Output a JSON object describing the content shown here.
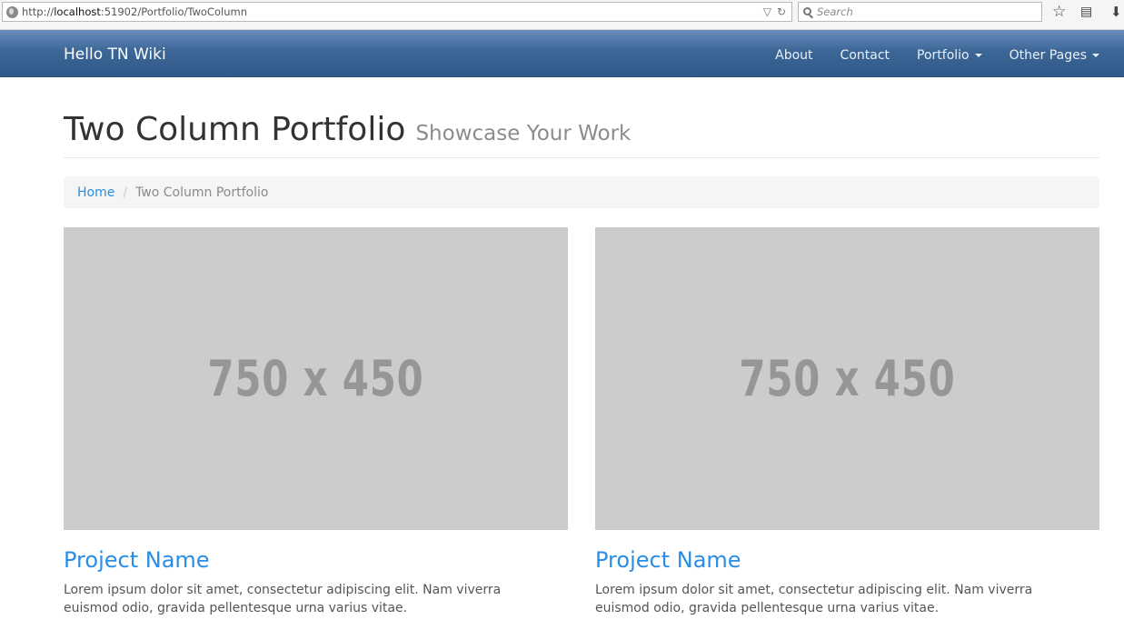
{
  "browser": {
    "url_prefix": "http://",
    "url_host": "localhost",
    "url_rest": ":51902/Portfolio/TwoColumn",
    "search_placeholder": "Search",
    "icons": [
      "globe-icon",
      "dropdown-arrow-icon",
      "reload-icon",
      "search-icon",
      "star-icon",
      "clipboard-icon",
      "download-icon"
    ]
  },
  "navbar": {
    "brand": "Hello TN Wiki",
    "items": [
      {
        "label": "About"
      },
      {
        "label": "Contact"
      },
      {
        "label": "Portfolio"
      },
      {
        "label": "Other Pages"
      }
    ],
    "colors": {
      "background": "#3b6696",
      "text": "#eaf0f7"
    }
  },
  "header": {
    "title": "Two Column Portfolio",
    "subtitle": "Showcase Your Work"
  },
  "breadcrumb": {
    "home": "Home",
    "separator": "/",
    "current": "Two Column Portfolio"
  },
  "projects": [
    {
      "image_label": "750 x 450",
      "name": "Project Name",
      "description": "Lorem ipsum dolor sit amet, consectetur adipiscing elit. Nam viverra euismod odio, gravida pellentesque urna varius vitae."
    },
    {
      "image_label": "750 x 450",
      "name": "Project Name",
      "description": "Lorem ipsum dolor sit amet, consectetur adipiscing elit. Nam viverra euismod odio, gravida pellentesque urna varius vitae."
    }
  ],
  "colors": {
    "link": "#2a8ee6",
    "placeholder_bg": "#cccccc",
    "placeholder_text": "#969696"
  }
}
